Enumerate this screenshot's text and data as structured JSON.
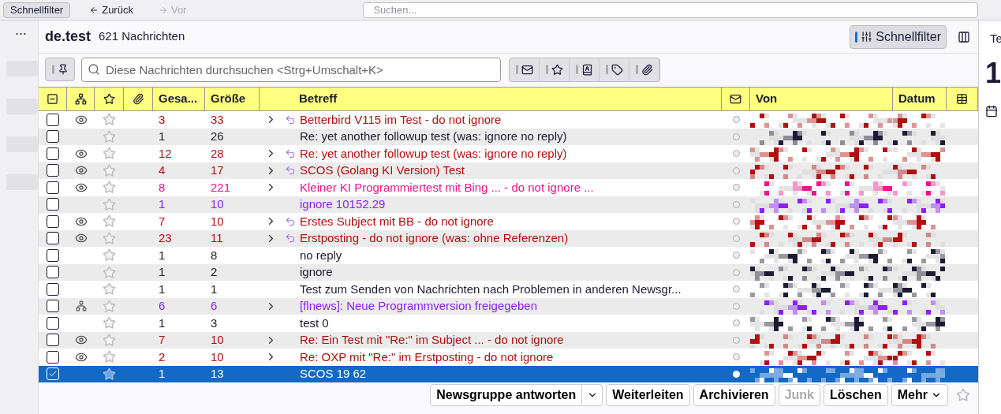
{
  "top_bar": {
    "buttons": [
      {
        "label": "Schnellfilter",
        "disabled": false
      },
      {
        "label": "Zurück",
        "disabled": false
      },
      {
        "label": "Vor",
        "disabled": true
      }
    ],
    "search": {
      "placeholder": "Suchen..."
    }
  },
  "folder_pane": {
    "menu": "⋯"
  },
  "folder": {
    "name": "de.test",
    "count": "621 Nachrichten"
  },
  "quick_filter_button": {
    "label": "Schnellfilter",
    "on": true
  },
  "filter_bar": {
    "pinned": false,
    "placeholder": "Diese Nachrichten durchsuchen <Strg+Umschalt+K>",
    "toggles": [
      {
        "kind": "unread",
        "on": false
      },
      {
        "kind": "starred",
        "on": false
      },
      {
        "kind": "contact",
        "on": false
      },
      {
        "kind": "tag",
        "on": false
      },
      {
        "kind": "attachment",
        "on": false
      }
    ]
  },
  "columns": [
    {
      "kind": "select"
    },
    {
      "kind": "thread"
    },
    {
      "kind": "star"
    },
    {
      "kind": "attachment"
    },
    {
      "kind": "text",
      "label": "Gesa..."
    },
    {
      "kind": "text",
      "label": "Größe"
    },
    {
      "kind": "text",
      "label": "Betreff"
    },
    {
      "kind": "junk"
    },
    {
      "kind": "text",
      "label": "Von"
    },
    {
      "kind": "text",
      "label": "Datum"
    },
    {
      "kind": "picker"
    }
  ],
  "rows": [
    {
      "checked": false,
      "selected": false,
      "watched": true,
      "ignored_thread": false,
      "starred": false,
      "count": "3",
      "size": "33",
      "collapsed_thread": true,
      "replied": true,
      "subject": "Betterbird V115 im Test - do not ignore",
      "color": "#b30f0f"
    },
    {
      "checked": false,
      "selected": false,
      "watched": false,
      "ignored_thread": false,
      "starred": false,
      "count": "1",
      "size": "26",
      "collapsed_thread": false,
      "replied": false,
      "subject": "Re: yet another followup test (was: ignore no reply)",
      "color": "#1c1b33"
    },
    {
      "checked": false,
      "selected": false,
      "watched": true,
      "ignored_thread": false,
      "starred": false,
      "count": "12",
      "size": "28",
      "collapsed_thread": true,
      "replied": true,
      "subject": "Re: yet another followup test (was: ignore no reply)",
      "color": "#b30f0f"
    },
    {
      "checked": false,
      "selected": false,
      "watched": true,
      "ignored_thread": false,
      "starred": false,
      "count": "4",
      "size": "17",
      "collapsed_thread": true,
      "replied": true,
      "subject": "SCOS (Golang KI Version) Test",
      "color": "#b30f0f"
    },
    {
      "checked": false,
      "selected": false,
      "watched": true,
      "ignored_thread": false,
      "starred": false,
      "count": "8",
      "size": "221",
      "collapsed_thread": true,
      "replied": false,
      "subject": "Kleiner KI Programmiertest mit Bing ... - do not ignore ...",
      "color": "#f0138a"
    },
    {
      "checked": false,
      "selected": false,
      "watched": false,
      "ignored_thread": false,
      "starred": false,
      "count": "1",
      "size": "10",
      "collapsed_thread": false,
      "replied": false,
      "subject": "ignore 10152.29",
      "color": "#8c1ff5"
    },
    {
      "checked": false,
      "selected": false,
      "watched": true,
      "ignored_thread": false,
      "starred": false,
      "count": "7",
      "size": "10",
      "collapsed_thread": true,
      "replied": true,
      "subject": "Erstes Subject mit BB - do not ignore",
      "color": "#b30f0f"
    },
    {
      "checked": false,
      "selected": false,
      "watched": true,
      "ignored_thread": false,
      "starred": false,
      "count": "23",
      "size": "11",
      "collapsed_thread": true,
      "replied": true,
      "subject": "Erstposting - do not ignore (was: ohne Referenzen)",
      "color": "#b30f0f"
    },
    {
      "checked": false,
      "selected": false,
      "watched": false,
      "ignored_thread": false,
      "starred": false,
      "count": "1",
      "size": "8",
      "collapsed_thread": false,
      "replied": false,
      "subject": "no reply",
      "color": "#1c1b33"
    },
    {
      "checked": false,
      "selected": false,
      "watched": false,
      "ignored_thread": false,
      "starred": false,
      "count": "1",
      "size": "2",
      "collapsed_thread": false,
      "replied": false,
      "subject": "ignore",
      "color": "#1c1b33"
    },
    {
      "checked": false,
      "selected": false,
      "watched": false,
      "ignored_thread": false,
      "starred": false,
      "count": "1",
      "size": "1",
      "collapsed_thread": false,
      "replied": false,
      "subject": "Test zum Senden von Nachrichten nach Problemen in anderen Newsgr...",
      "color": "#1c1b33"
    },
    {
      "checked": false,
      "selected": false,
      "watched": false,
      "ignored_thread": true,
      "starred": false,
      "count": "6",
      "size": "6",
      "collapsed_thread": true,
      "replied": false,
      "subject": "[flnews]: Neue Programmversion freigegeben",
      "color": "#8c1ff5"
    },
    {
      "checked": false,
      "selected": false,
      "watched": false,
      "ignored_thread": false,
      "starred": false,
      "count": "1",
      "size": "3",
      "collapsed_thread": false,
      "replied": false,
      "subject": "test 0",
      "color": "#1c1b33"
    },
    {
      "checked": false,
      "selected": false,
      "watched": true,
      "ignored_thread": false,
      "starred": false,
      "count": "7",
      "size": "10",
      "collapsed_thread": true,
      "replied": false,
      "subject": "Re: Ein Test mit \"Re:\" im Subject ... - do not ignore",
      "color": "#b30f0f"
    },
    {
      "checked": false,
      "selected": false,
      "watched": true,
      "ignored_thread": false,
      "starred": false,
      "count": "2",
      "size": "10",
      "collapsed_thread": true,
      "replied": false,
      "subject": "Re: OXP mit \"Re:\" im Erstposting - do not ignore",
      "color": "#b30f0f"
    },
    {
      "checked": true,
      "selected": true,
      "watched": false,
      "ignored_thread": false,
      "starred": false,
      "count": "1",
      "size": "13",
      "collapsed_thread": false,
      "replied": false,
      "subject": "SCOS 19 62"
    }
  ],
  "actions": [
    {
      "label": "Newsgruppe antworten",
      "disabled": false,
      "dropdown": true
    },
    {
      "label": "Weiterleiten",
      "disabled": false,
      "dropdown": false
    },
    {
      "label": "Archivieren",
      "disabled": false,
      "dropdown": false
    },
    {
      "label": "Junk",
      "disabled": true,
      "dropdown": false
    },
    {
      "label": "Löschen",
      "disabled": false,
      "dropdown": false
    },
    {
      "label": "Mehr",
      "disabled": false,
      "dropdown": true
    }
  ],
  "right_panel": {
    "tab": "Te",
    "big": "1"
  }
}
